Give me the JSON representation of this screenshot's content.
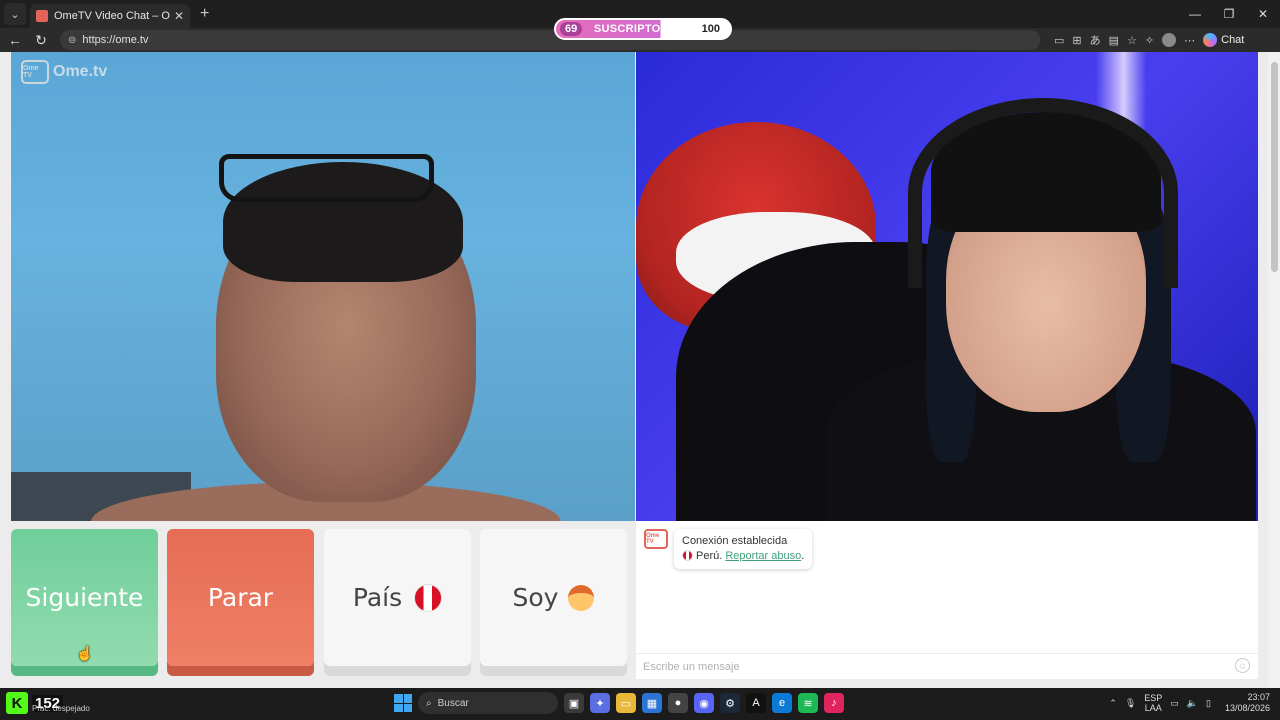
{
  "browser": {
    "tab_title": "OmeTV Video Chat – Omegle",
    "url": "https://ome.tv",
    "chat_button_label": "Chat"
  },
  "overlay": {
    "subs_current": "69",
    "subs_label": "SUSCRIPTORES",
    "subs_goal": "100"
  },
  "site": {
    "logo_text": "Ome.tv",
    "logo_badge": "Ome TV"
  },
  "controls": {
    "next_label": "Siguiente",
    "stop_label": "Parar",
    "country_label": "País",
    "soy_label": "Soy"
  },
  "chat": {
    "status_line": "Conexión establecida",
    "country_text": "Perú.",
    "report_link": "Reportar abuso",
    "report_suffix": ".",
    "input_placeholder": "Escribe un mensaje"
  },
  "taskbar": {
    "kick_count": "152",
    "weather_text": "Prac. despejado",
    "search_placeholder": "Buscar",
    "lang_top": "ESP",
    "lang_bottom": "LAA",
    "time": "23:07",
    "date": "13/08/2026"
  },
  "colors": {
    "next_green": "#6fce9a",
    "stop_red": "#e56c55",
    "pill_pink": "#e56cb9",
    "kick_green": "#53fc18"
  }
}
